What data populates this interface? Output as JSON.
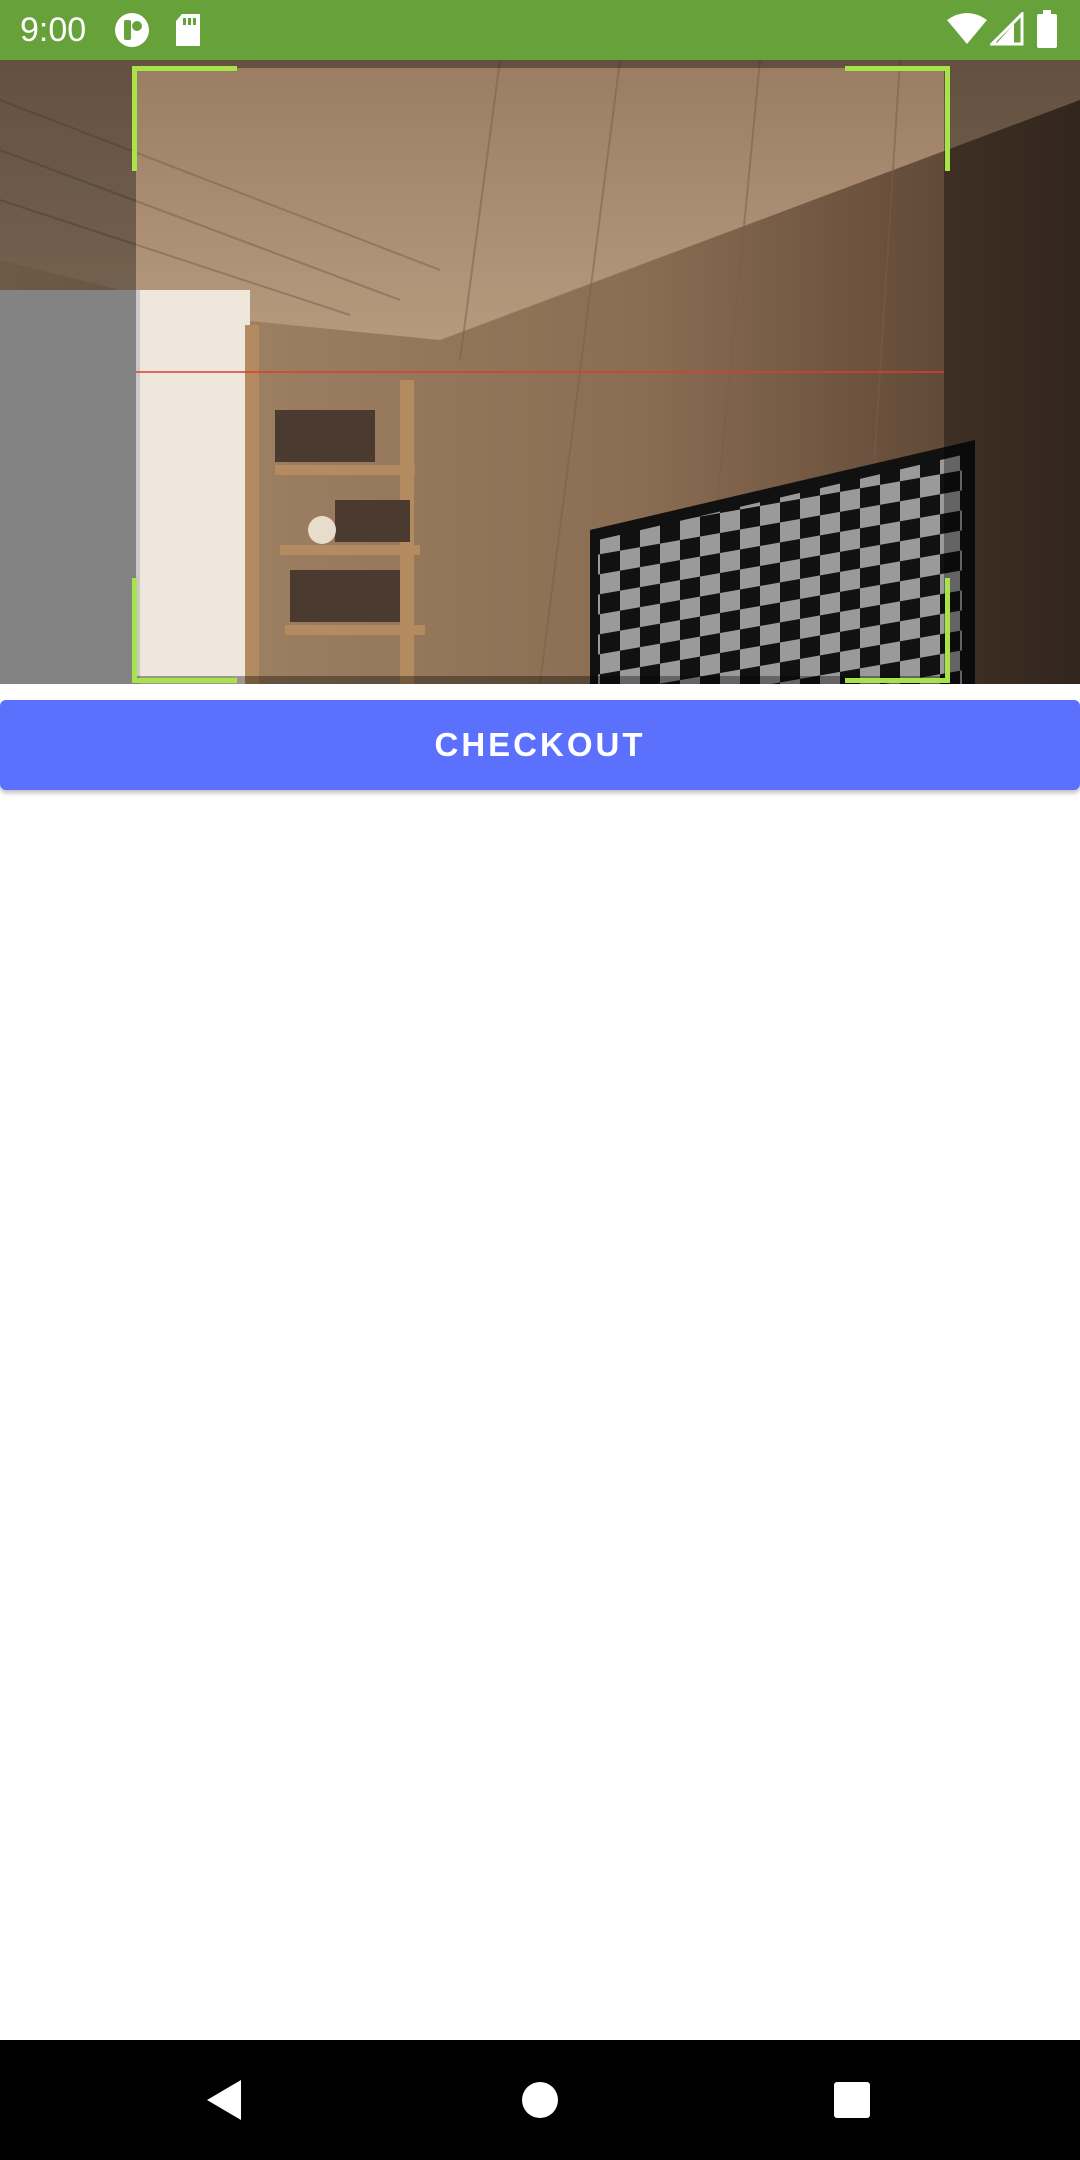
{
  "status_bar": {
    "time": "9:00",
    "icons": [
      "privacy-indicator-icon",
      "sd-card-icon",
      "wifi-icon",
      "signal-icon",
      "battery-icon"
    ],
    "background_color": "#66a139"
  },
  "scanner": {
    "frame_color": "#a8e34a",
    "scan_line_color": "#dc3c32"
  },
  "checkout_button": {
    "label": "CHECKOUT",
    "color": "#5b70fd"
  },
  "nav_bar": {
    "icons": [
      "back-icon",
      "home-icon",
      "recents-icon"
    ]
  }
}
